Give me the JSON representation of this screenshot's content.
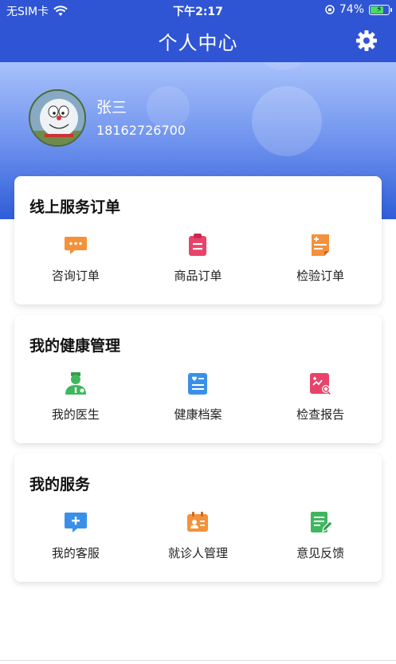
{
  "status_bar": {
    "carrier": "无SIM卡",
    "time": "下午2:17",
    "battery_text": "74%",
    "battery_level": 0.74
  },
  "nav": {
    "title": "个人中心"
  },
  "user": {
    "name": "张三",
    "phone": "18162726700"
  },
  "sections": [
    {
      "title": "线上服务订单",
      "items": [
        {
          "label": "咨询订单",
          "icon": "chat-bubble-icon",
          "color": "#f5913a"
        },
        {
          "label": "商品订单",
          "icon": "clipboard-icon",
          "color": "#e8436a"
        },
        {
          "label": "检验订单",
          "icon": "lab-report-icon",
          "color": "#f5913a"
        }
      ]
    },
    {
      "title": "我的健康管理",
      "items": [
        {
          "label": "我的医生",
          "icon": "doctor-icon",
          "color": "#3fb75e"
        },
        {
          "label": "健康档案",
          "icon": "health-record-icon",
          "color": "#3a90e8"
        },
        {
          "label": "检查报告",
          "icon": "check-report-icon",
          "color": "#e8436a"
        }
      ]
    },
    {
      "title": "我的服务",
      "items": [
        {
          "label": "我的客服",
          "icon": "customer-service-icon",
          "color": "#3a90e8"
        },
        {
          "label": "就诊人管理",
          "icon": "patient-card-icon",
          "color": "#f5913a"
        },
        {
          "label": "意见反馈",
          "icon": "feedback-icon",
          "color": "#3fb75e"
        }
      ]
    }
  ]
}
